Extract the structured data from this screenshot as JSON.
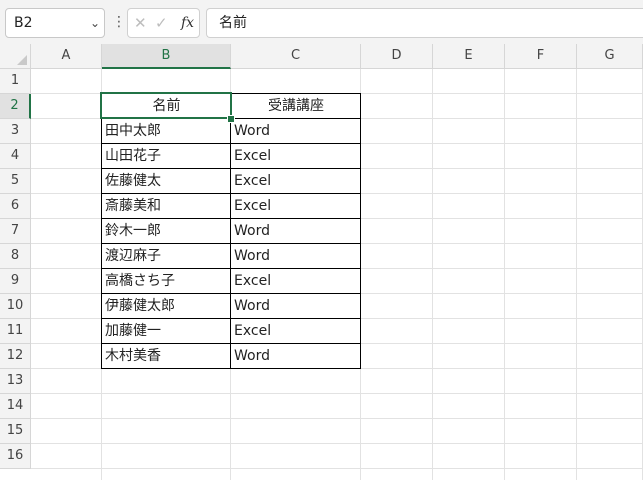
{
  "formula_bar": {
    "name_box": "B2",
    "name_box_dropdown_icon": "chevron-down-icon",
    "more_icon": "vertical-ellipsis-icon",
    "cancel_icon": "close-icon",
    "enter_icon": "check-icon",
    "function_label": "fx",
    "formula": "名前"
  },
  "sheet": {
    "columns": [
      "A",
      "B",
      "C",
      "D",
      "E",
      "F",
      "G"
    ],
    "rows": [
      "1",
      "2",
      "3",
      "4",
      "5",
      "6",
      "7",
      "8",
      "9",
      "10",
      "11",
      "12",
      "13",
      "14",
      "15",
      "16"
    ],
    "selected_column": "B",
    "selected_row": "2",
    "active_cell": "B2",
    "accent_color": "#217346"
  },
  "table": {
    "headers": [
      "名前",
      "受講講座"
    ],
    "rows": [
      [
        "田中太郎",
        "Word"
      ],
      [
        "山田花子",
        "Excel"
      ],
      [
        "佐藤健太",
        "Excel"
      ],
      [
        "斎藤美和",
        "Excel"
      ],
      [
        "鈴木一郎",
        "Word"
      ],
      [
        "渡辺麻子",
        "Word"
      ],
      [
        "高橋さち子",
        "Excel"
      ],
      [
        "伊藤健太郎",
        "Word"
      ],
      [
        "加藤健一",
        "Excel"
      ],
      [
        "木村美香",
        "Word"
      ]
    ]
  }
}
